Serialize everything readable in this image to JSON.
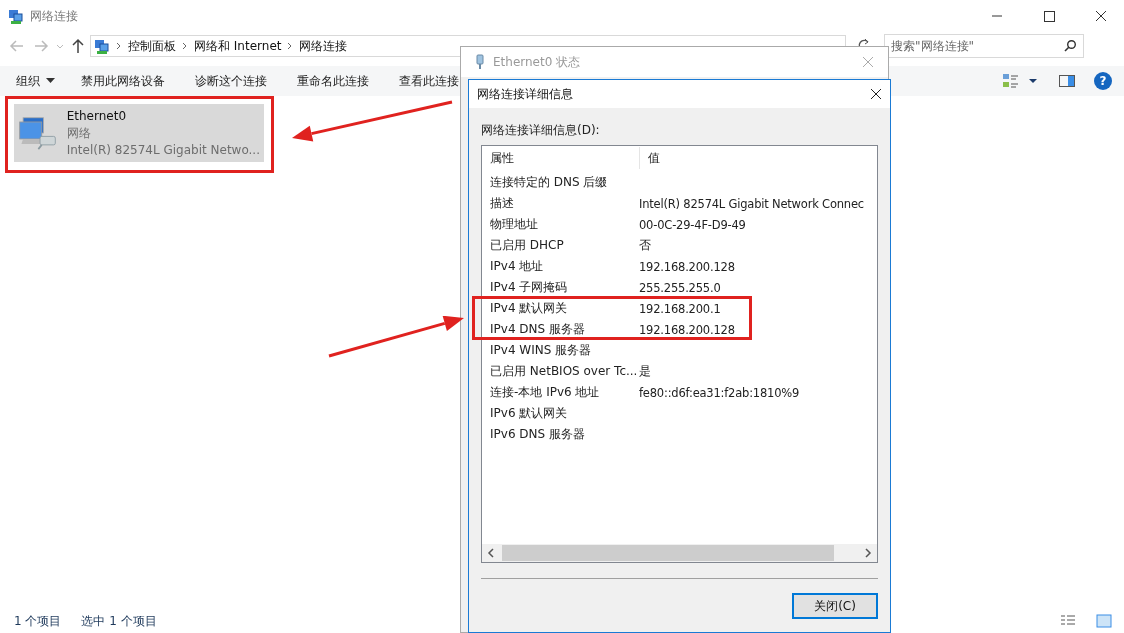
{
  "window": {
    "title": "网络连接"
  },
  "address": {
    "path": [
      "控制面板",
      "网络和 Internet",
      "网络连接"
    ]
  },
  "search": {
    "placeholder": "搜索\"网络连接\""
  },
  "toolbar": {
    "items": [
      {
        "label": "组织",
        "kind": "menu"
      },
      {
        "label": "禁用此网络设备",
        "kind": "button"
      },
      {
        "label": "诊断这个连接",
        "kind": "button"
      },
      {
        "label": "重命名此连接",
        "kind": "button"
      },
      {
        "label": "查看此连接",
        "kind": "button"
      }
    ],
    "help": "?"
  },
  "connections": [
    {
      "name": "Ethernet0",
      "network": "网络",
      "device": "Intel(R) 82574L Gigabit Netwo...",
      "selected": true
    }
  ],
  "status_bar": [
    "1 个项目",
    "选中 1 个项目"
  ],
  "status_dialog": {
    "title": "Ethernet0 状态"
  },
  "details_dialog": {
    "title": "网络连接详细信息",
    "label": "网络连接详细信息(D):",
    "columns": [
      "属性",
      "值"
    ],
    "rows": [
      {
        "property": "连接特定的 DNS 后缀"
      },
      {
        "property": "描述",
        "value": "Intel(R) 82574L Gigabit Network Connec"
      },
      {
        "property": "物理地址",
        "value": "00-0C-29-4F-D9-49"
      },
      {
        "property": "已启用 DHCP",
        "value": "否"
      },
      {
        "property": "IPv4 地址",
        "value": "192.168.200.128"
      },
      {
        "property": "IPv4 子网掩码",
        "value": "255.255.255.0"
      },
      {
        "property": "IPv4 默认网关",
        "value": "192.168.200.1"
      },
      {
        "property": "IPv4 DNS 服务器",
        "value": "192.168.200.128"
      },
      {
        "property": "IPv4 WINS 服务器"
      },
      {
        "property": "已启用 NetBIOS over Tc...",
        "value": "是"
      },
      {
        "property": "连接-本地 IPv6 地址",
        "value": "fe80::d6f:ea31:f2ab:1810%9"
      },
      {
        "property": "IPv6 默认网关"
      },
      {
        "property": "IPv6 DNS 服务器"
      }
    ],
    "close_button": "关闭(C)"
  }
}
